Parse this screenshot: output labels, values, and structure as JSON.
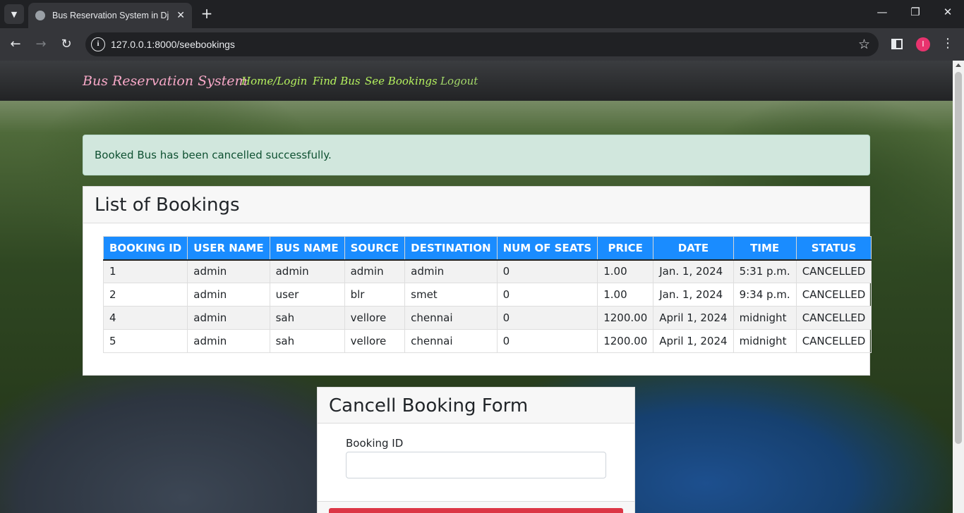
{
  "browser": {
    "tab_title": "Bus Reservation System in Djan",
    "url": "127.0.0.1:8000/seebookings",
    "profile_initial": "I"
  },
  "navbar": {
    "brand": "Bus Reservation System",
    "links": [
      "Home/Login",
      "Find Bus",
      "See Bookings",
      "Logout"
    ]
  },
  "alert": {
    "message": "Booked Bus has been cancelled successfully."
  },
  "bookings": {
    "title": "List of Bookings",
    "columns": [
      "BOOKING ID",
      "USER NAME",
      "BUS NAME",
      "SOURCE",
      "DESTINATION",
      "NUM OF SEATS",
      "PRICE",
      "DATE",
      "TIME",
      "STATUS"
    ],
    "rows": [
      [
        "1",
        "admin",
        "admin",
        "admin",
        "admin",
        "0",
        "1.00",
        "Jan. 1, 2024",
        "5:31 p.m.",
        "CANCELLED"
      ],
      [
        "2",
        "admin",
        "user",
        "blr",
        "smet",
        "0",
        "1.00",
        "Jan. 1, 2024",
        "9:34 p.m.",
        "CANCELLED"
      ],
      [
        "4",
        "admin",
        "sah",
        "vellore",
        "chennai",
        "0",
        "1200.00",
        "April 1, 2024",
        "midnight",
        "CANCELLED"
      ],
      [
        "5",
        "admin",
        "sah",
        "vellore",
        "chennai",
        "0",
        "1200.00",
        "April 1, 2024",
        "midnight",
        "CANCELLED"
      ]
    ]
  },
  "cancel_form": {
    "title": "Cancell Booking Form",
    "field_label": "Booking ID",
    "field_value": "",
    "submit_label": ""
  },
  "colors": {
    "brand": "#f7a8c7",
    "nav_link": "#b5f25e",
    "table_header": "#1a8cff",
    "alert_bg": "#d1e7dd",
    "submit": "#dc3545"
  }
}
